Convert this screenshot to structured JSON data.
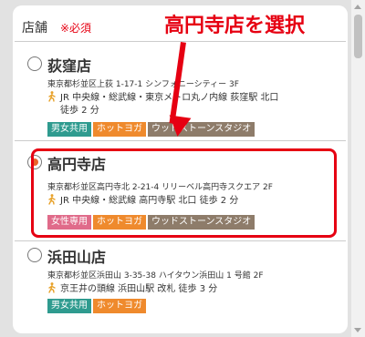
{
  "form": {
    "section_title": "店舗",
    "required": "※必須"
  },
  "stores": [
    {
      "name": "荻窪店",
      "checked": false,
      "address": "東京都杉並区上荻 1-17-1 シンフォニーシティー 3F",
      "access_line1": "JR 中央線・総武線・東京メトロ丸ノ内線 荻窪駅 北口",
      "access_line2": "徒歩 2 分",
      "tags": [
        {
          "label": "男女共用",
          "color": "green"
        },
        {
          "label": "ホットヨガ",
          "color": "orange"
        },
        {
          "label": "ウッドストーンスタジオ",
          "color": "brown"
        }
      ]
    },
    {
      "name": "高円寺店",
      "checked": true,
      "address": "東京都杉並区高円寺北 2-21-4 リリーベル高円寺スクエア 2F",
      "access_line1": "JR 中央線・総武線 高円寺駅 北口 徒歩 2 分",
      "tags": [
        {
          "label": "女性専用",
          "color": "pink"
        },
        {
          "label": "ホットヨガ",
          "color": "orange"
        },
        {
          "label": "ウッドストーンスタジオ",
          "color": "brown"
        }
      ]
    },
    {
      "name": "浜田山店",
      "checked": false,
      "address": "東京都杉並区浜田山 3-35-38 ハイタウン浜田山 1 号館 2F",
      "access_line1": "京王井の頭線 浜田山駅 改札 徒歩 3 分",
      "tags": [
        {
          "label": "男女共用",
          "color": "green"
        },
        {
          "label": "ホットヨガ",
          "color": "orange"
        }
      ]
    }
  ],
  "annotation": {
    "callout": "高円寺店を選択"
  },
  "colors": {
    "accent": "#e60012",
    "radio_selected": "#e8632b",
    "tag_green": "#2f9b8f",
    "tag_orange": "#ef8a2d",
    "tag_brown": "#8e7c6a",
    "tag_pink": "#e06b8a"
  },
  "icons": {
    "walk": "walking-person-icon"
  }
}
